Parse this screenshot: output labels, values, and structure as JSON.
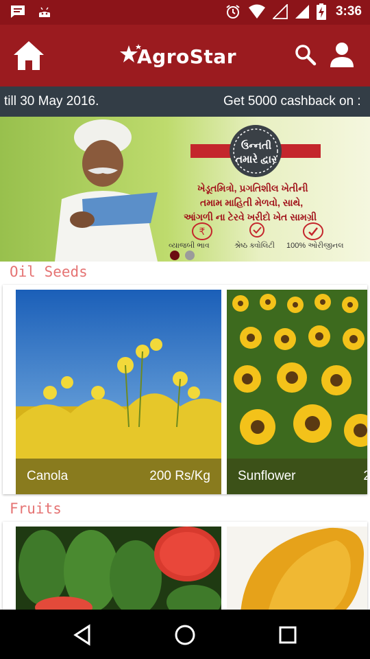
{
  "status_bar": {
    "time": "3:36",
    "icons": [
      "message-icon",
      "android-icon",
      "alarm-icon",
      "wifi-icon",
      "signal-empty-icon",
      "signal-icon",
      "battery-charging-icon"
    ]
  },
  "app_bar": {
    "logo_text": "AgroStar",
    "icons": [
      "home-icon",
      "search-icon",
      "user-icon"
    ]
  },
  "ticker": {
    "text_a": "till 30 May 2016.",
    "text_b": "Get 5000 cashback on :"
  },
  "banner": {
    "emblem_line1": "ઉન્નતી",
    "emblem_line2": "તમારે દ્વાર",
    "line1": "ખેડૂતમિત્રો, પ્રગતિશીલ ખેતીની",
    "line2": "તમામ માહિતી મેળવો, સાથે,",
    "line3": "આંગળી ના ટેરવે ખરીદો ખેત સામગ્રી",
    "badge1": "વ્યાજબી ભાવ",
    "badge2": "શ્રેષ્ઠ ક્વોલિટી",
    "badge3": "100% ઓરીજીનલ",
    "carousel_page": 1,
    "carousel_total": 2
  },
  "sections": [
    {
      "title": "Oil Seeds",
      "items": [
        {
          "name": "Canola",
          "price": "200 Rs/Kg"
        },
        {
          "name": "Sunflower",
          "price": "2"
        }
      ]
    },
    {
      "title": "Fruits",
      "items": [
        {
          "name": "",
          "price": ""
        },
        {
          "name": "",
          "price": ""
        }
      ]
    }
  ],
  "nav": {
    "icons": [
      "back-icon",
      "home-circle-icon",
      "recents-icon"
    ]
  },
  "colors": {
    "brand_red": "#9b1b1f",
    "status_red": "#8c1419",
    "ticker_bg": "#333d46",
    "section_title": "#e57373"
  }
}
